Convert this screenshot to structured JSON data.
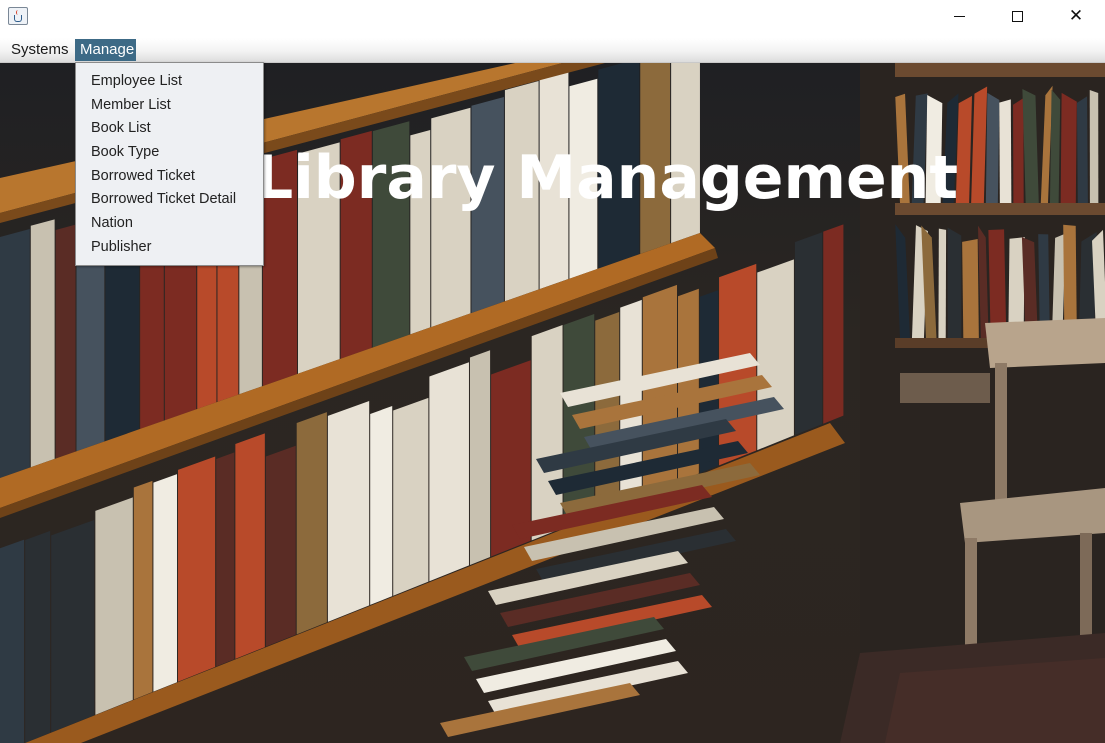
{
  "window": {
    "minimize_icon": "minimize-icon",
    "maximize_icon": "maximize-icon",
    "close_glyph": "✕"
  },
  "menubar": {
    "menus": [
      {
        "label": "Systems"
      },
      {
        "label": "Manage",
        "active": true
      }
    ]
  },
  "manage_menu": {
    "items": [
      {
        "label": "Employee List"
      },
      {
        "label": "Member List"
      },
      {
        "label": "Book List"
      },
      {
        "label": "Book Type"
      },
      {
        "label": "Borrowed Ticket"
      },
      {
        "label": "Borrowed Ticket Detail"
      },
      {
        "label": "Nation"
      },
      {
        "label": "Publisher"
      }
    ]
  },
  "main": {
    "heading": "Library Management"
  },
  "colors": {
    "menu_highlight": "#3d6a86",
    "dropdown_bg": "#eef0f3",
    "heading_text": "#ffffff"
  }
}
